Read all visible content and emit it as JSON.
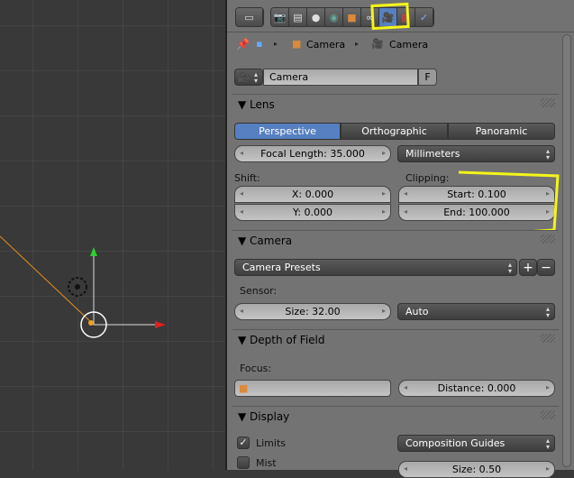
{
  "header": {
    "tabs": [
      "render-icon",
      "render-layers-icon",
      "scene-icon",
      "world-icon",
      "object-icon",
      "constraints-icon",
      "camera-data-icon",
      "texture-icon",
      "physics-icon"
    ],
    "active_tab": "camera-data-icon"
  },
  "breadcrumb": {
    "object": "Camera",
    "data": "Camera"
  },
  "datablock": {
    "name": "Camera",
    "fake_user": "F"
  },
  "lens": {
    "title": "Lens",
    "types": [
      "Perspective",
      "Orthographic",
      "Panoramic"
    ],
    "active_type": "Perspective",
    "focal_length": "Focal Length: 35.000",
    "unit": "Millimeters",
    "shift_label": "Shift:",
    "shift_x": "X: 0.000",
    "shift_y": "Y: 0.000",
    "clipping_label": "Clipping:",
    "clip_start": "Start: 0.100",
    "clip_end": "End: 100.000"
  },
  "camera": {
    "title": "Camera",
    "presets": "Camera Presets",
    "add": "+",
    "remove": "−",
    "sensor_label": "Sensor:",
    "size": "Size: 32.00",
    "fit": "Auto"
  },
  "dof": {
    "title": "Depth of Field",
    "focus_label": "Focus:",
    "distance": "Distance: 0.000"
  },
  "display": {
    "title": "Display",
    "limits": "Limits",
    "limits_checked": true,
    "mist": "Mist",
    "mist_checked": false,
    "guides": "Composition Guides",
    "size": "Size: 0.50"
  },
  "colors": {
    "accent": "#5680c2",
    "annotation": "#f4f41a"
  }
}
